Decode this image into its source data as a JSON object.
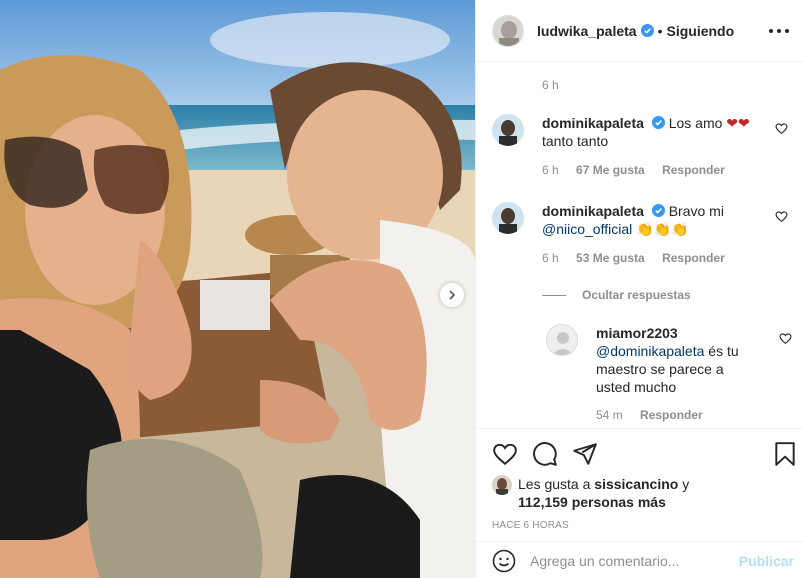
{
  "header": {
    "username": "ludwika_paleta",
    "separator": "•",
    "follow_status": "Siguiendo"
  },
  "post": {
    "caption_time": "6 h"
  },
  "comments": [
    {
      "username": "dominikapaleta",
      "text": "Los amo",
      "text_line2": "tanto tanto",
      "emoji": "❤❤",
      "time": "6 h",
      "likes": "67 Me gusta",
      "reply": "Responder"
    },
    {
      "username": "dominikapaleta",
      "text": "Bravo mi",
      "mention": "@niico_official",
      "emoji": "👏👏👏",
      "time": "6 h",
      "likes": "53 Me gusta",
      "reply": "Responder"
    }
  ],
  "hide_replies_label": "Ocultar respuestas",
  "reply": {
    "username": "miamor2203",
    "mention": "@dominikapaleta",
    "text": "és tu maestro se parece a usted mucho",
    "time": "54 m",
    "reply": "Responder"
  },
  "likes": {
    "prefix": "Les gusta a",
    "user": "sissicancino",
    "conj": "y",
    "count": "112,159 personas más"
  },
  "time_ago": "HACE 6 HORAS",
  "add_comment": {
    "placeholder": "Agrega un comentario...",
    "publish": "Publicar"
  },
  "colors": {
    "verified": "#3897f0",
    "mention": "#00376b",
    "muted": "#8e8e8e",
    "publish_disabled": "#b2dffc",
    "heart_red": "#c0282d"
  },
  "icons": [
    "heart-icon",
    "comment-icon",
    "share-icon",
    "bookmark-icon",
    "smiley-icon",
    "more-icon",
    "verified-icon",
    "chevron-right-icon"
  ]
}
